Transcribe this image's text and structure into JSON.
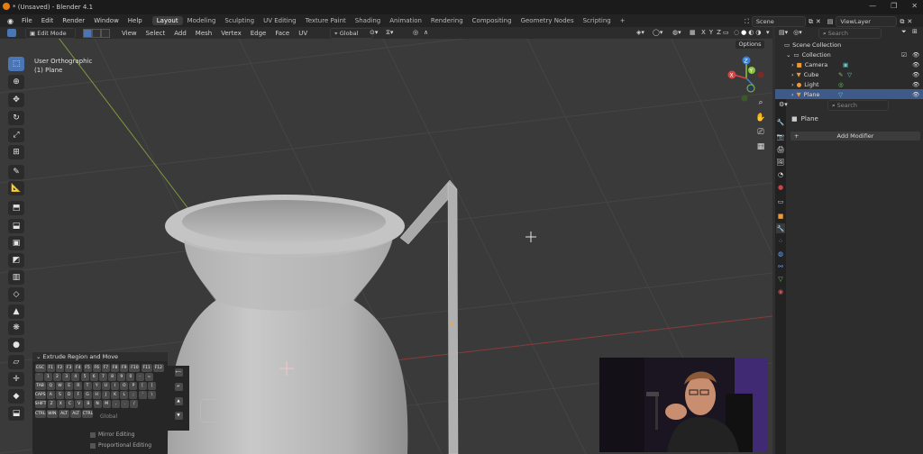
{
  "window": {
    "title": "* (Unsaved) - Blender 4.1"
  },
  "menus": [
    "File",
    "Edit",
    "Render",
    "Window",
    "Help"
  ],
  "workspaces": [
    "Layout",
    "Modeling",
    "Sculpting",
    "UV Editing",
    "Texture Paint",
    "Shading",
    "Animation",
    "Rendering",
    "Compositing",
    "Geometry Nodes",
    "Scripting"
  ],
  "active_workspace": "Layout",
  "scene": {
    "name": "Scene",
    "view_layer": "ViewLayer"
  },
  "viewport_header": {
    "mode": "Edit Mode",
    "menus": [
      "View",
      "Select",
      "Add",
      "Mesh",
      "Vertex",
      "Edge",
      "Face",
      "UV"
    ],
    "transform": "Global",
    "axes": [
      "X",
      "Y",
      "Z"
    ],
    "options_label": "Options"
  },
  "viewport": {
    "view_name": "User Orthographic",
    "object_label": "(1) Plane"
  },
  "gizmo": {
    "x": "X",
    "y": "Y",
    "z": "Z"
  },
  "outliner": {
    "search_placeholder": "Search",
    "root": "Scene Collection",
    "items": [
      {
        "label": "Collection",
        "icon": "collection-icon"
      },
      {
        "label": "Camera",
        "icon": "camera-icon"
      },
      {
        "label": "Cube",
        "icon": "mesh-icon"
      },
      {
        "label": "Light",
        "icon": "light-icon"
      },
      {
        "label": "Plane",
        "icon": "mesh-icon",
        "selected": true
      }
    ]
  },
  "properties": {
    "search_placeholder": "Search",
    "object_name": "Plane",
    "add_modifier_label": "Add Modifier"
  },
  "operator_panel": {
    "title": "Extrude Region and Move",
    "orientation": "Global",
    "mirror_label": "Mirror Editing",
    "proportional_label": "Proportional Editing"
  },
  "keyboard": {
    "rows": [
      [
        "ESC",
        "F1",
        "F2",
        "F3",
        "F4",
        "F5",
        "F6",
        "F7",
        "F8",
        "F9",
        "F10",
        "F11",
        "F12"
      ],
      [
        "`",
        "1",
        "2",
        "3",
        "4",
        "5",
        "6",
        "7",
        "8",
        "9",
        "0",
        "-",
        "="
      ],
      [
        "TAB",
        "Q",
        "W",
        "E",
        "R",
        "T",
        "Y",
        "U",
        "I",
        "O",
        "P",
        "[",
        "]"
      ],
      [
        "CAPS",
        "A",
        "S",
        "D",
        "F",
        "G",
        "H",
        "J",
        "K",
        "L",
        ";",
        "'",
        "\\"
      ],
      [
        "SHIFT",
        "Z",
        "X",
        "C",
        "V",
        "B",
        "N",
        "M",
        ",",
        ".",
        "/"
      ],
      [
        "CTRL",
        "WIN",
        "ALT",
        "ALT",
        "CTRL"
      ]
    ]
  },
  "colors": {
    "accent": "#4a76b5",
    "selection": "#3e5a8a",
    "x_axis": "#d64541",
    "y_axis": "#8ac43f",
    "z_axis": "#3b82d6"
  }
}
